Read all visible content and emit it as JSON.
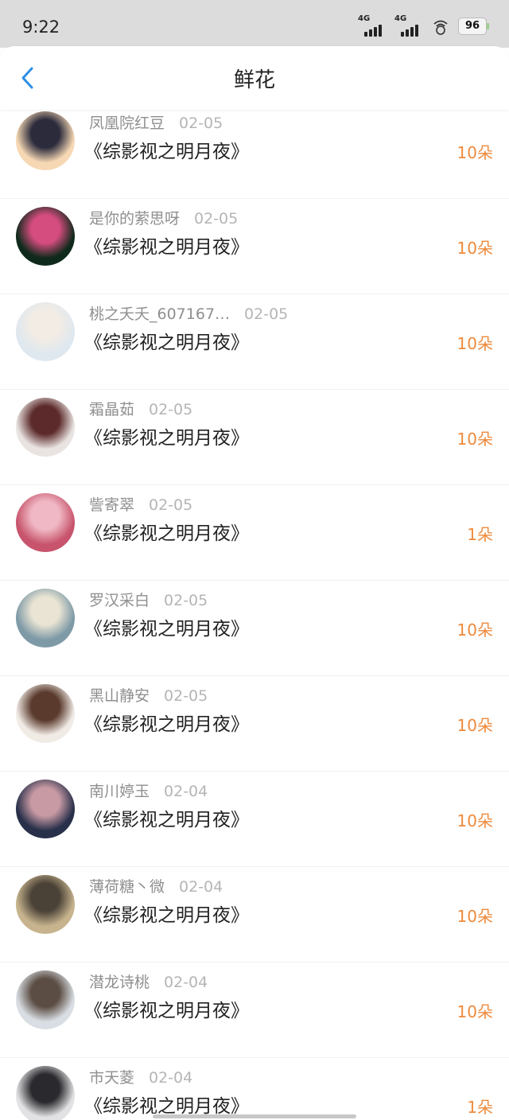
{
  "status_bar": {
    "time": "9:22",
    "network": [
      "4G",
      "4G"
    ],
    "battery": "96"
  },
  "header": {
    "title": "鲜花"
  },
  "colors": {
    "accent": "#2e8fe6",
    "count": "#ee8a3c"
  },
  "rows": [
    {
      "user": "凤凰院红豆",
      "date": "02-05",
      "book": "《综影视之明月夜》",
      "count": "10朵",
      "avatar_colors": [
        "#f6d8b4",
        "#2b2b3c"
      ]
    },
    {
      "user": "是你的萦思呀",
      "date": "02-05",
      "book": "《综影视之明月夜》",
      "count": "10朵",
      "avatar_colors": [
        "#0f2a1c",
        "#d54c7e"
      ]
    },
    {
      "user": "桃之夭夭_607167…",
      "date": "02-05",
      "book": "《综影视之明月夜》",
      "count": "10朵",
      "avatar_colors": [
        "#dfe8ef",
        "#f3ece4"
      ]
    },
    {
      "user": "霜晶茹",
      "date": "02-05",
      "book": "《综影视之明月夜》",
      "count": "10朵",
      "avatar_colors": [
        "#e9e4e2",
        "#5c2a2a"
      ]
    },
    {
      "user": "訾寄翠",
      "date": "02-05",
      "book": "《综影视之明月夜》",
      "count": "1朵",
      "avatar_colors": [
        "#c7546c",
        "#f0b8c4"
      ]
    },
    {
      "user": "罗汉采白",
      "date": "02-05",
      "book": "《综影视之明月夜》",
      "count": "10朵",
      "avatar_colors": [
        "#7e9aa7",
        "#e9e4d3"
      ]
    },
    {
      "user": "黑山静安",
      "date": "02-05",
      "book": "《综影视之明月夜》",
      "count": "10朵",
      "avatar_colors": [
        "#f1ebe6",
        "#5a3a2c"
      ]
    },
    {
      "user": "南川婷玉",
      "date": "02-04",
      "book": "《综影视之明月夜》",
      "count": "10朵",
      "avatar_colors": [
        "#28304a",
        "#c89aa4"
      ]
    },
    {
      "user": "薄荷糖丶微",
      "date": "02-04",
      "book": "《综影视之明月夜》",
      "count": "10朵",
      "avatar_colors": [
        "#c7b48e",
        "#4b4237"
      ]
    },
    {
      "user": "潜龙诗桃",
      "date": "02-04",
      "book": "《综影视之明月夜》",
      "count": "10朵",
      "avatar_colors": [
        "#d9dee4",
        "#5b4d43"
      ]
    },
    {
      "user": "市天菱",
      "date": "02-04",
      "book": "《综影视之明月夜》",
      "count": "1朵",
      "avatar_colors": [
        "#e2e2e4",
        "#2a2a2e"
      ]
    }
  ]
}
